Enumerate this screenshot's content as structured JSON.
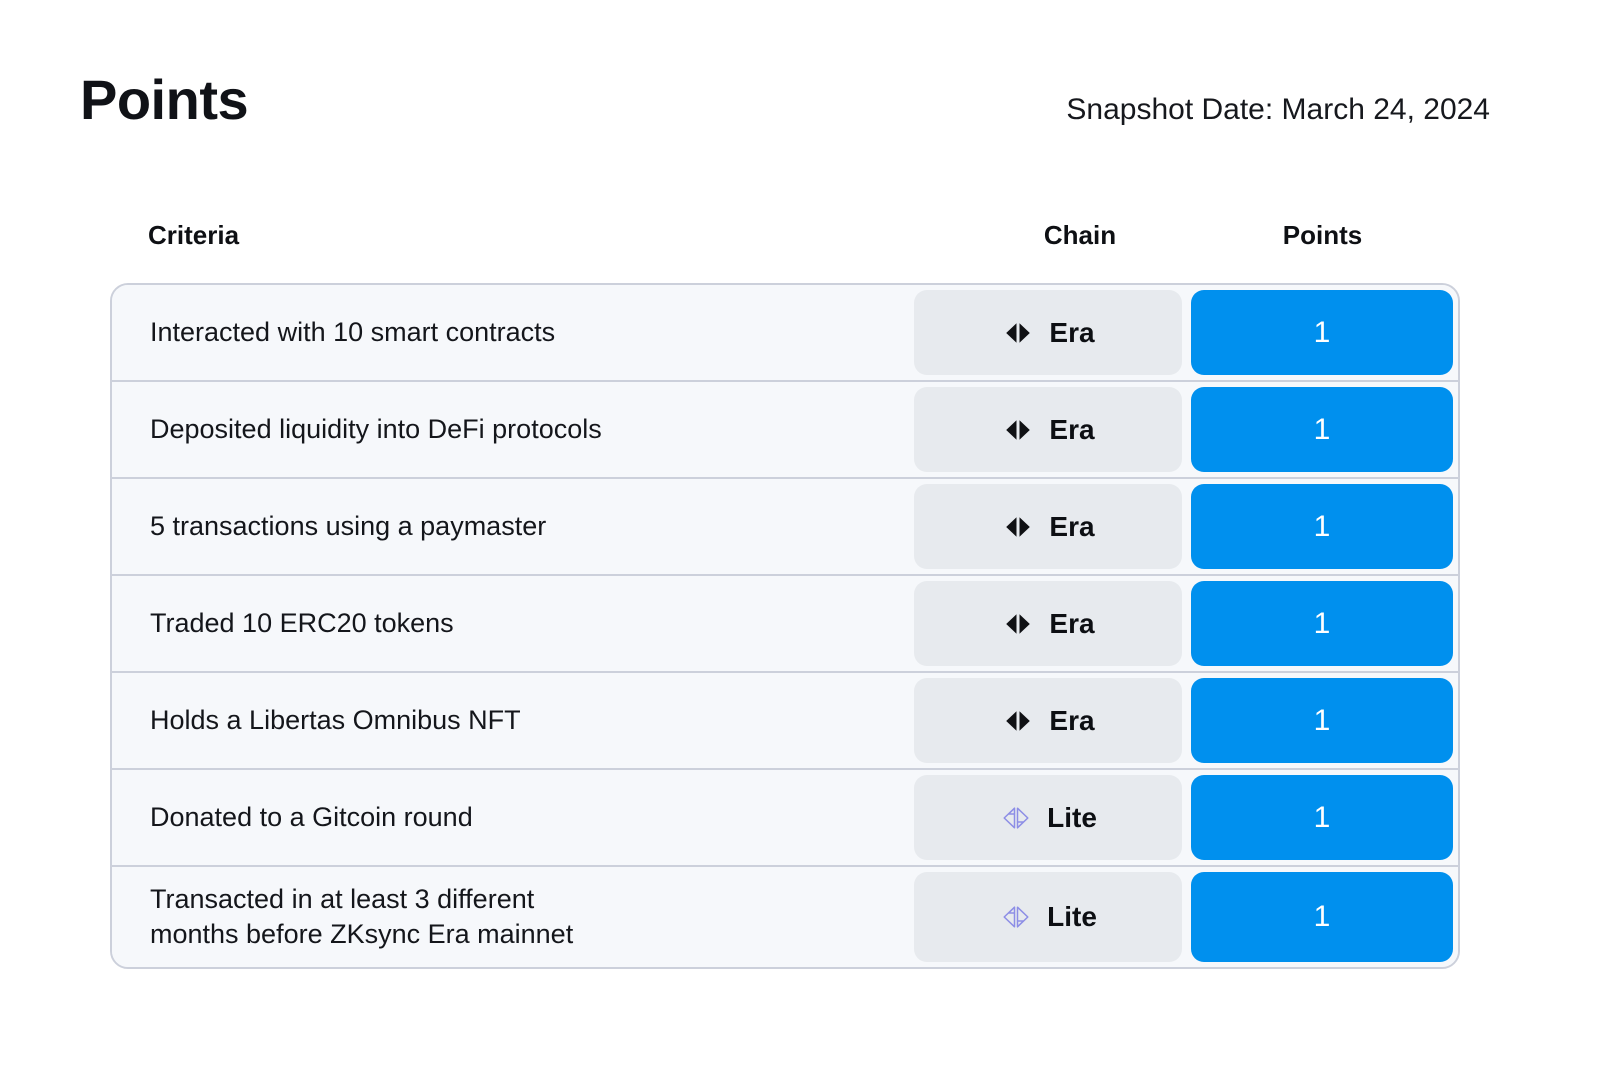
{
  "header": {
    "title": "Points",
    "snapshot_date": "Snapshot Date: March 24, 2024"
  },
  "table": {
    "columns": {
      "criteria": "Criteria",
      "chain": "Chain",
      "points": "Points"
    },
    "rows": [
      {
        "criteria": "Interacted with 10 smart contracts",
        "chain": "Era",
        "chain_icon": "zksync-era-arrows-icon",
        "points": "1"
      },
      {
        "criteria": "Deposited liquidity into DeFi protocols",
        "chain": "Era",
        "chain_icon": "zksync-era-arrows-icon",
        "points": "1"
      },
      {
        "criteria": "5 transactions using a paymaster",
        "chain": "Era",
        "chain_icon": "zksync-era-arrows-icon",
        "points": "1"
      },
      {
        "criteria": "Traded 10 ERC20 tokens",
        "chain": "Era",
        "chain_icon": "zksync-era-arrows-icon",
        "points": "1"
      },
      {
        "criteria": "Holds a Libertas Omnibus NFT",
        "chain": "Era",
        "chain_icon": "zksync-era-arrows-icon",
        "points": "1"
      },
      {
        "criteria": "Donated to a Gitcoin round",
        "chain": "Lite",
        "chain_icon": "zksync-lite-arrows-outline-icon",
        "points": "1"
      },
      {
        "criteria": "Transacted in at least 3 different\nmonths before ZKsync Era mainnet",
        "chain": "Lite",
        "chain_icon": "zksync-lite-arrows-outline-icon",
        "points": "1"
      }
    ]
  },
  "colors": {
    "background": "#ffffff",
    "row_background": "#f6f8fb",
    "row_divider": "#ccd0db",
    "chain_badge_background": "#e7eaee",
    "points_badge_background": "#0090ee",
    "points_badge_text": "#ffffff",
    "text_primary": "#14161b",
    "era_icon_color": "#101114",
    "lite_icon_color": "#8d8ee6"
  }
}
